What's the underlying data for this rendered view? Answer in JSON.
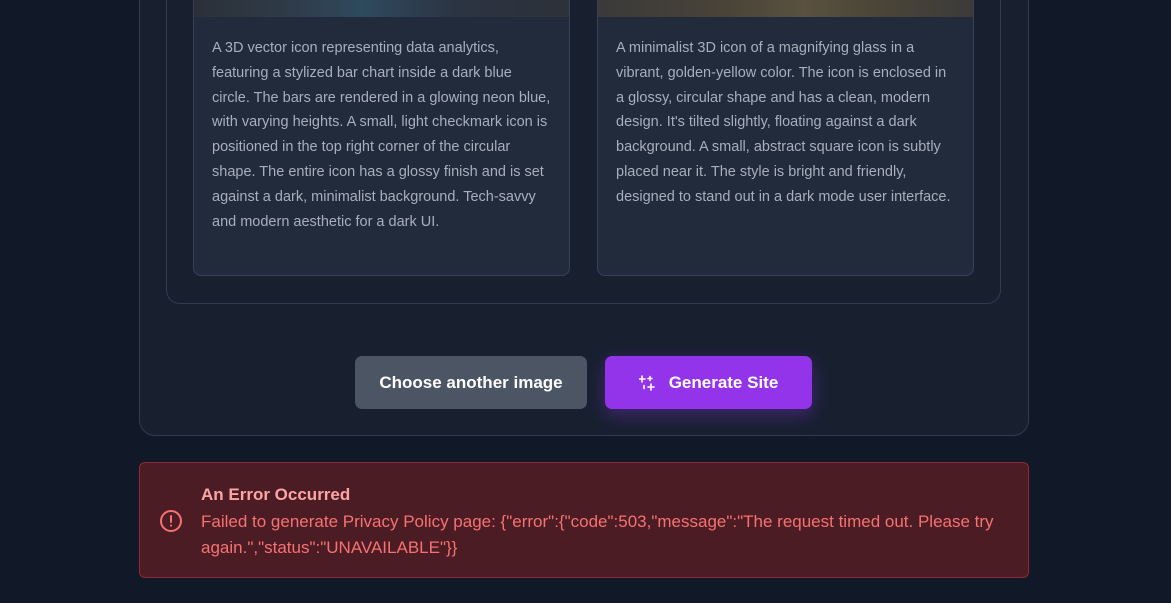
{
  "cards": [
    {
      "description": "A 3D vector icon representing data analytics, featuring a stylized bar chart inside a dark blue circle. The bars are rendered in a glowing neon blue, with varying heights. A small, light checkmark icon is positioned in the top right corner of the circular shape. The entire icon has a glossy finish and is set against a dark, minimalist background. Tech-savvy and modern aesthetic for a dark UI."
    },
    {
      "description": "A minimalist 3D icon of a magnifying glass in a vibrant, golden-yellow color. The icon is enclosed in a glossy, circular shape and has a clean, modern design. It's tilted slightly, floating against a dark background. A small, abstract square icon is subtly placed near it. The style is bright and friendly, designed to stand out in a dark mode user interface."
    }
  ],
  "actions": {
    "choose_another_label": "Choose another image",
    "generate_label": "Generate Site",
    "generate_icon": "sparkle-icon"
  },
  "error": {
    "icon": "alert-circle-icon",
    "title": "An Error Occurred",
    "message": "Failed to generate Privacy Policy page: {\"error\":{\"code\":503,\"message\":\"The request timed out. Please try again.\",\"status\":\"UNAVAILABLE\"}}"
  },
  "colors": {
    "background": "#111827",
    "primary_button": "#9333ea",
    "secondary_button": "#4b5563",
    "error_background": "#4b1c24",
    "error_text": "#f87171"
  }
}
